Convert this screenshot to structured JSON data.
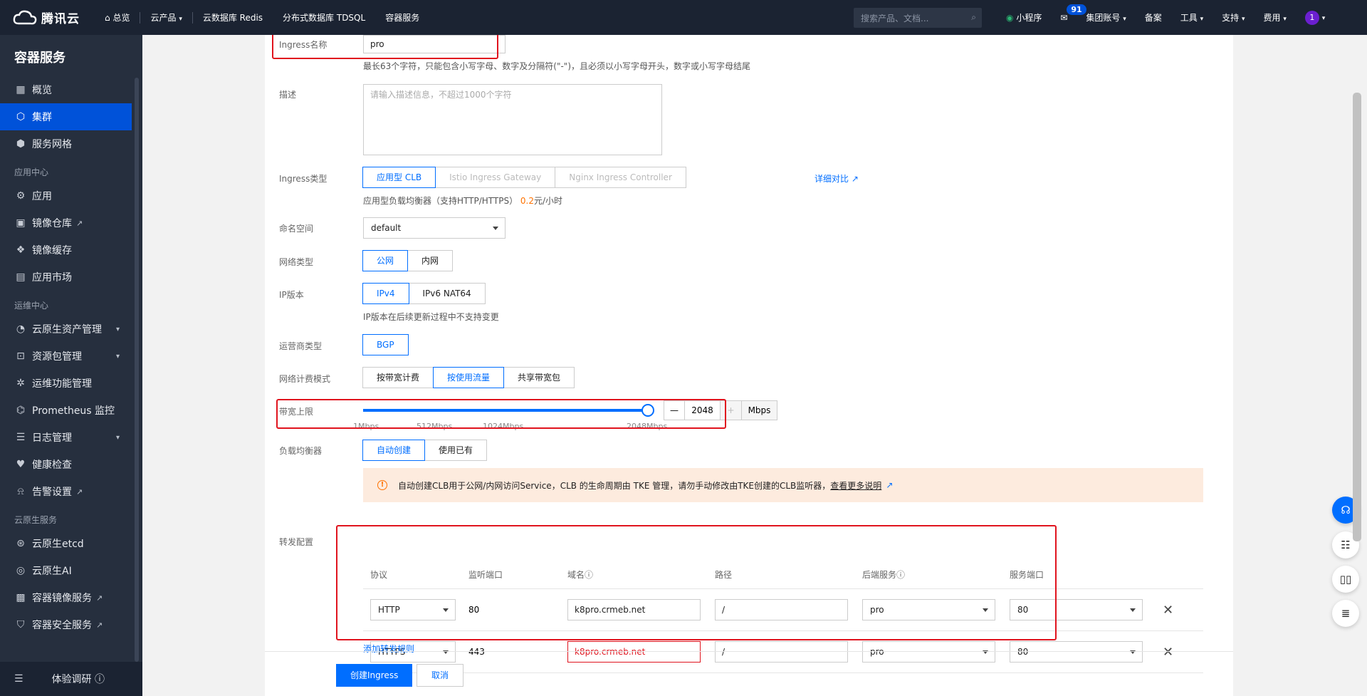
{
  "topbar": {
    "brand": "腾讯云",
    "home": "总览",
    "products": "云产品",
    "nav": [
      "云数据库 Redis",
      "分布式数据库 TDSQL",
      "容器服务"
    ],
    "search_placeholder": "搜索产品、文档...",
    "mini": "小程序",
    "mail_count": "91",
    "account": "集团账号",
    "beian": "备案",
    "tools": "工具",
    "support": "支持",
    "fee": "费用",
    "avatar": "1"
  },
  "sidebar": {
    "title": "容器服务",
    "items_a": [
      {
        "label": "概览",
        "icon": "grid-icon"
      },
      {
        "label": "集群",
        "icon": "cluster-icon"
      },
      {
        "label": "服务网格",
        "icon": "mesh-icon"
      }
    ],
    "group_app": "应用中心",
    "items_b": [
      {
        "label": "应用",
        "icon": "app-icon"
      },
      {
        "label": "镜像仓库",
        "icon": "image-icon"
      },
      {
        "label": "镜像缓存",
        "icon": "cache-icon"
      },
      {
        "label": "应用市场",
        "icon": "market-icon"
      }
    ],
    "group_ops": "运维中心",
    "items_c": [
      {
        "label": "云原生资产管理"
      },
      {
        "label": "资源包管理"
      },
      {
        "label": "运维功能管理"
      },
      {
        "label": "Prometheus 监控"
      },
      {
        "label": "日志管理"
      },
      {
        "label": "健康检查"
      },
      {
        "label": "告警设置"
      }
    ],
    "group_native": "云原生服务",
    "items_d": [
      {
        "label": "云原生etcd"
      },
      {
        "label": "云原生AI"
      },
      {
        "label": "容器镜像服务"
      },
      {
        "label": "容器安全服务"
      }
    ],
    "footer": "体验调研"
  },
  "form": {
    "name_label": "Ingress名称",
    "name_value": "pro",
    "name_hint": "最长63个字符，只能包含小写字母、数字及分隔符(\"-\")，且必须以小写字母开头，数字或小写字母结尾",
    "desc_label": "描述",
    "desc_placeholder": "请输入描述信息，不超过1000个字符",
    "type_label": "Ingress类型",
    "type_opts": [
      "应用型 CLB",
      "Istio Ingress Gateway",
      "Nginx Ingress Controller"
    ],
    "type_compare": "详细对比",
    "type_hint_a": "应用型负载均衡器（支持HTTP/HTTPS）",
    "type_hint_price": "0.2",
    "type_hint_b": "元/小时",
    "ns_label": "命名空间",
    "ns_value": "default",
    "net_label": "网络类型",
    "net_opts": [
      "公网",
      "内网"
    ],
    "ip_label": "IP版本",
    "ip_opts": [
      "IPv4",
      "IPv6 NAT64"
    ],
    "ip_hint": "IP版本在后续更新过程中不支持变更",
    "isp_label": "运营商类型",
    "isp_opts": [
      "BGP"
    ],
    "bill_label": "网络计费模式",
    "bill_opts": [
      "按带宽计费",
      "按使用流量",
      "共享带宽包"
    ],
    "bw_label": "带宽上限",
    "bw_value": "2048",
    "bw_unit": "Mbps",
    "bw_ticks": [
      "1Mbps",
      "512Mbps",
      "1024Mbps",
      "2048Mbps"
    ],
    "bw_fraction": 1.0,
    "lb_label": "负载均衡器",
    "lb_opts": [
      "自动创建",
      "使用已有"
    ],
    "alert": "自动创建CLB用于公网/内网访问Service，CLB 的生命周期由 TKE 管理，请勿手动修改由TKE创建的CLB监听器，",
    "alert_link": "查看更多说明",
    "fwd_label": "转发配置",
    "cols": [
      "协议",
      "监听端口",
      "域名",
      "路径",
      "后端服务",
      "服务端口"
    ],
    "rows": [
      {
        "proto": "HTTP",
        "port": "80",
        "domain": "k8pro.crmeb.net",
        "path": "/",
        "svc": "pro",
        "svcport": "80"
      },
      {
        "proto": "HTTPS",
        "port": "443",
        "domain": "k8pro.crmeb.net",
        "path": "/",
        "svc": "pro",
        "svcport": "80"
      }
    ],
    "add_rule": "添加转发规则",
    "create": "创建Ingress",
    "cancel": "取消"
  },
  "colors": {
    "accent": "#006eff",
    "danger": "#e0141e",
    "warn": "#ff7200"
  }
}
